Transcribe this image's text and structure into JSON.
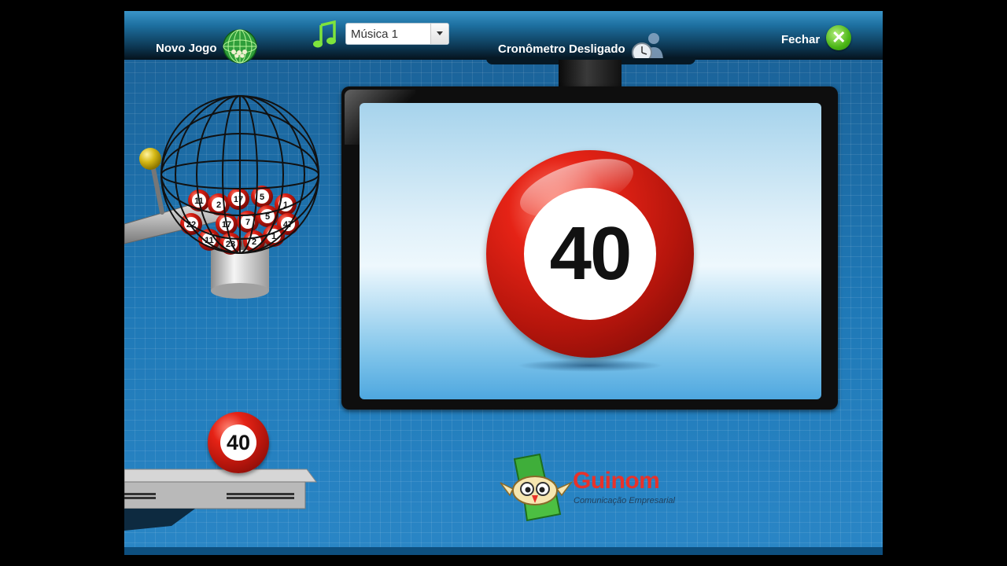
{
  "toolbar": {
    "new_game_label": "Novo Jogo",
    "music_select": {
      "selected": "Música 1"
    },
    "timer_label": "Cronômetro Desligado",
    "close_label": "Fechar",
    "icons": {
      "new_game": "globe-bingo-icon",
      "music": "music-note-icon",
      "timer": "clock-person-icon",
      "close": "close-icon"
    }
  },
  "display": {
    "current_number": "40"
  },
  "machine": {
    "cage_balls": [
      "11",
      "2",
      "17",
      "5",
      "1",
      "22",
      "17",
      "7",
      "5",
      "47",
      "11",
      "23",
      "2",
      "1"
    ],
    "drawn_ball": "40"
  },
  "brand": {
    "name": "Guinom",
    "tagline": "Comunicação Empresarial"
  },
  "colors": {
    "ball_red": "#d91f13",
    "background_blue": "#1c6ea7",
    "close_green": "#4ab516",
    "music_green": "#7ee43c",
    "brand_red": "#e8322a"
  }
}
